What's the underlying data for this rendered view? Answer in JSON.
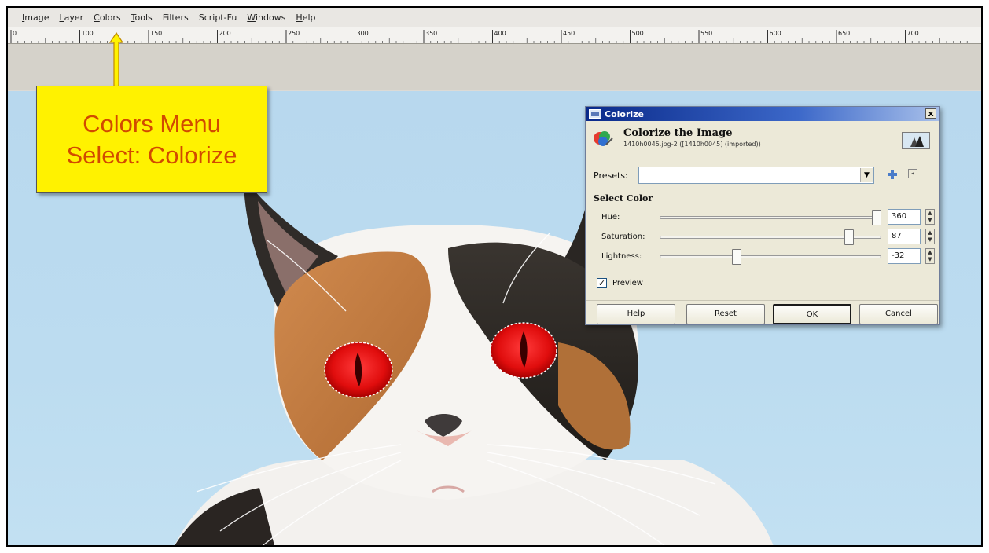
{
  "menubar": {
    "items": [
      {
        "first": "I",
        "rest": "mage"
      },
      {
        "first": "L",
        "rest": "ayer"
      },
      {
        "first": "C",
        "rest": "olors"
      },
      {
        "first": "T",
        "rest": "ools"
      },
      {
        "first": "",
        "rest": "Filters"
      },
      {
        "first": "",
        "rest": "Script-Fu"
      },
      {
        "first": "W",
        "rest": "indows"
      },
      {
        "first": "H",
        "rest": "elp"
      }
    ]
  },
  "ruler": {
    "labels": [
      "0",
      "100",
      "150",
      "200",
      "250",
      "300",
      "350",
      "400",
      "450",
      "500",
      "550",
      "600",
      "650",
      "700"
    ]
  },
  "callout": {
    "line1": "Colors Menu",
    "line2": "Select: Colorize",
    "bg_color": "#fff200",
    "text_color": "#d24a00"
  },
  "dialog": {
    "title": "Colorize",
    "close_label": "x",
    "heading": "Colorize the Image",
    "subheading": "1410h0045.jpg-2 ([1410h0045] (imported))",
    "presets": {
      "label": "Presets:",
      "value": ""
    },
    "section_title": "Select Color",
    "sliders": [
      {
        "label": "Hue:",
        "value": "360",
        "fraction": 1.0
      },
      {
        "label": "Saturation:",
        "value": "87",
        "fraction": 0.87
      },
      {
        "label": "Lightness:",
        "value": "-32",
        "fraction": 0.34
      }
    ],
    "preview": {
      "label": "Preview",
      "checked": true
    },
    "buttons": {
      "help": "Help",
      "reset": "Reset",
      "ok": "OK",
      "cancel": "Cancel"
    }
  }
}
